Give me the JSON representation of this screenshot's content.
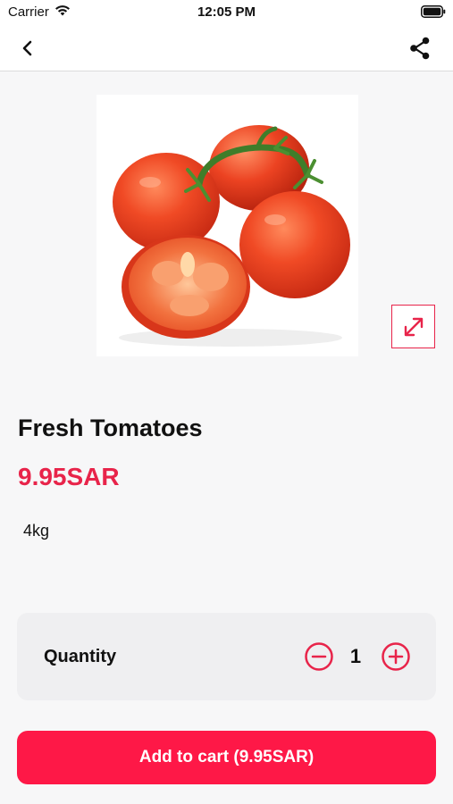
{
  "status_bar": {
    "carrier": "Carrier",
    "time": "12:05 PM",
    "icons": [
      "wifi-icon",
      "battery-icon"
    ]
  },
  "nav": {
    "icons": [
      "chevron-left-icon",
      "share-icon"
    ]
  },
  "product": {
    "image": "tomatoes-on-vine-photo",
    "title": "Fresh Tomatoes",
    "price": "9.95SAR",
    "weight": "4kg",
    "expand_icon": "expand-arrows-icon"
  },
  "quantity": {
    "label": "Quantity",
    "value": "1",
    "minus_icon": "minus-circle-icon",
    "plus_icon": "plus-circle-icon"
  },
  "cart_button": {
    "label": "Add to cart (9.95SAR)"
  },
  "colors": {
    "accent": "#e8244a",
    "button": "#fe1847",
    "background": "#f7f7f8",
    "card": "#efeff1"
  }
}
